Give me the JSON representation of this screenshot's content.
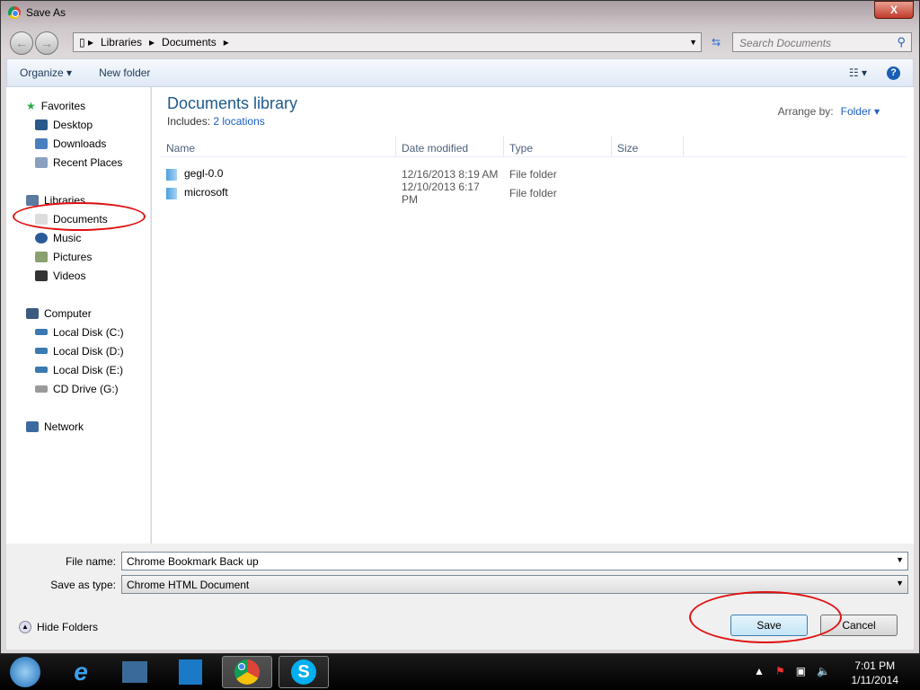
{
  "window": {
    "title": "Save As",
    "close": "X"
  },
  "address": {
    "crumbs": [
      "Libraries",
      "Documents"
    ],
    "search_placeholder": "Search Documents"
  },
  "toolbar": {
    "organize": "Organize ▾",
    "new_folder": "New folder",
    "view": "☷ ▾",
    "help": "?"
  },
  "sidebar": {
    "groups": [
      {
        "label": "Favorites",
        "items": [
          "Desktop",
          "Downloads",
          "Recent Places"
        ]
      },
      {
        "label": "Libraries",
        "items": [
          "Documents",
          "Music",
          "Pictures",
          "Videos"
        ]
      },
      {
        "label": "Computer",
        "items": [
          "Local Disk (C:)",
          "Local Disk (D:)",
          "Local Disk (E:)",
          "CD Drive (G:)"
        ]
      },
      {
        "label": "Network",
        "items": []
      }
    ]
  },
  "main": {
    "title": "Documents library",
    "includes": "Includes:",
    "locations": "2 locations",
    "arrange_label": "Arrange by:",
    "arrange_value": "Folder ▾",
    "columns": [
      "Name",
      "Date modified",
      "Type",
      "Size"
    ],
    "rows": [
      {
        "name": "gegl-0.0",
        "date": "12/16/2013 8:19 AM",
        "type": "File folder"
      },
      {
        "name": "microsoft",
        "date": "12/10/2013 6:17 PM",
        "type": "File folder"
      }
    ]
  },
  "form": {
    "file_name_label": "File name:",
    "file_name": "Chrome Bookmark Back up",
    "type_label": "Save as type:",
    "type_value": "Chrome HTML Document",
    "hide_folders": "Hide Folders",
    "save": "Save",
    "cancel": "Cancel"
  },
  "taskbar": {
    "time": "7:01 PM",
    "date": "1/11/2014",
    "apps": [
      "start",
      "internet-explorer",
      "file-explorer",
      "media-player",
      "chrome",
      "skype"
    ]
  },
  "annotations": {
    "color": "#e01010"
  }
}
